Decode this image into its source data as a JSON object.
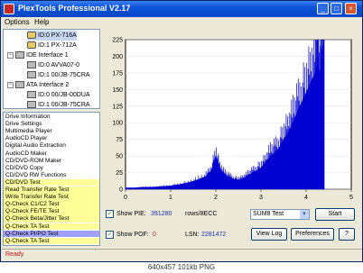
{
  "window": {
    "title": "PlexTools Professional V2.17"
  },
  "menu": [
    "Options",
    "Help"
  ],
  "tree": [
    {
      "label": "ID:0  PX-716A",
      "type": "cd",
      "selected": true
    },
    {
      "label": "ID:1  PX-712A",
      "type": "cd"
    },
    {
      "label": "IDE Interface 1",
      "type": "bus"
    },
    {
      "label": "ID:0  AVVA07-0",
      "type": "disk"
    },
    {
      "label": "ID:1  00/JB-75CRA",
      "type": "disk"
    },
    {
      "label": "ATA Interface 2",
      "type": "bus"
    },
    {
      "label": "ID:0  00/JB-00DUA",
      "type": "disk"
    },
    {
      "label": "ID:1  00/JB-75CRA",
      "type": "disk"
    }
  ],
  "functions": [
    {
      "label": "Drive Information",
      "hl": false
    },
    {
      "label": "Drive Settings",
      "hl": false
    },
    {
      "label": "Multimedia Player",
      "hl": false
    },
    {
      "label": "AudioCD Player",
      "hl": false
    },
    {
      "label": "Digital Audio Extraction",
      "hl": false
    },
    {
      "label": "AudioCD Maker",
      "hl": false
    },
    {
      "label": "CD/DVD-ROM Maker",
      "hl": false
    },
    {
      "label": "CD/DVD Copy",
      "hl": false
    },
    {
      "label": "CD/DVD RW Functions",
      "hl": false
    },
    {
      "label": "CD/DVD Test",
      "hl": true
    },
    {
      "label": "Read Transfer Rate Test",
      "hl": true
    },
    {
      "label": "Write Transfer Rate Test",
      "hl": true
    },
    {
      "label": "Q-Check C1/C2 Test",
      "hl": true
    },
    {
      "label": "Q-Check FE/TE Test",
      "hl": true
    },
    {
      "label": "Q-Check Beta/Jitter Test",
      "hl": true
    },
    {
      "label": "Q-Check TA Test",
      "hl": true
    },
    {
      "label": "Q-Check PI/PO Test",
      "hl": true,
      "selected": true
    },
    {
      "label": "Q-Check TA Test",
      "hl": true
    }
  ],
  "chart_data": {
    "type": "area",
    "ylim": [
      0,
      225
    ],
    "xlim": [
      0,
      5
    ],
    "yticks": [
      "0",
      "25",
      "50",
      "75",
      "100",
      "125",
      "150",
      "175",
      "200",
      "225"
    ],
    "xticks": [
      "0",
      "1",
      "2",
      "3",
      "4",
      "5"
    ],
    "color": "#0000d0",
    "series": [
      {
        "x": [
          0,
          0.2,
          0.4,
          0.6,
          0.8,
          1.0,
          1.2,
          1.4,
          1.6,
          1.8,
          1.9,
          2.0,
          2.1,
          2.2,
          2.3,
          2.4,
          2.5,
          2.6,
          2.7,
          2.8,
          2.9,
          3.0,
          3.1,
          3.2,
          3.3,
          3.4,
          3.5,
          3.6,
          3.7,
          3.8,
          3.9,
          4.0,
          4.1,
          4.2,
          4.25,
          4.3,
          4.35,
          4.4
        ],
        "y": [
          2,
          2,
          3,
          3,
          4,
          5,
          7,
          10,
          14,
          20,
          28,
          50,
          30,
          22,
          18,
          15,
          14,
          16,
          20,
          24,
          28,
          32,
          40,
          50,
          55,
          62,
          75,
          85,
          100,
          115,
          130,
          145,
          160,
          175,
          190,
          170,
          210,
          225
        ]
      }
    ]
  },
  "controls": {
    "show_pie_label": "Show PIE:",
    "pie_value": "391280",
    "pie_unit": "rows/8ECC",
    "show_pof_label": "Show POF:",
    "pof_value": "0",
    "lsn_label": "LSN:",
    "lsn_value": "2281472",
    "mode_select": "SUM8 Test",
    "start_label": "Start",
    "viewlog_label": "View Log",
    "preferences_label": "Preferences",
    "help_label": "?"
  },
  "status": "Ready",
  "caption": "640x457  101kb  PNG"
}
